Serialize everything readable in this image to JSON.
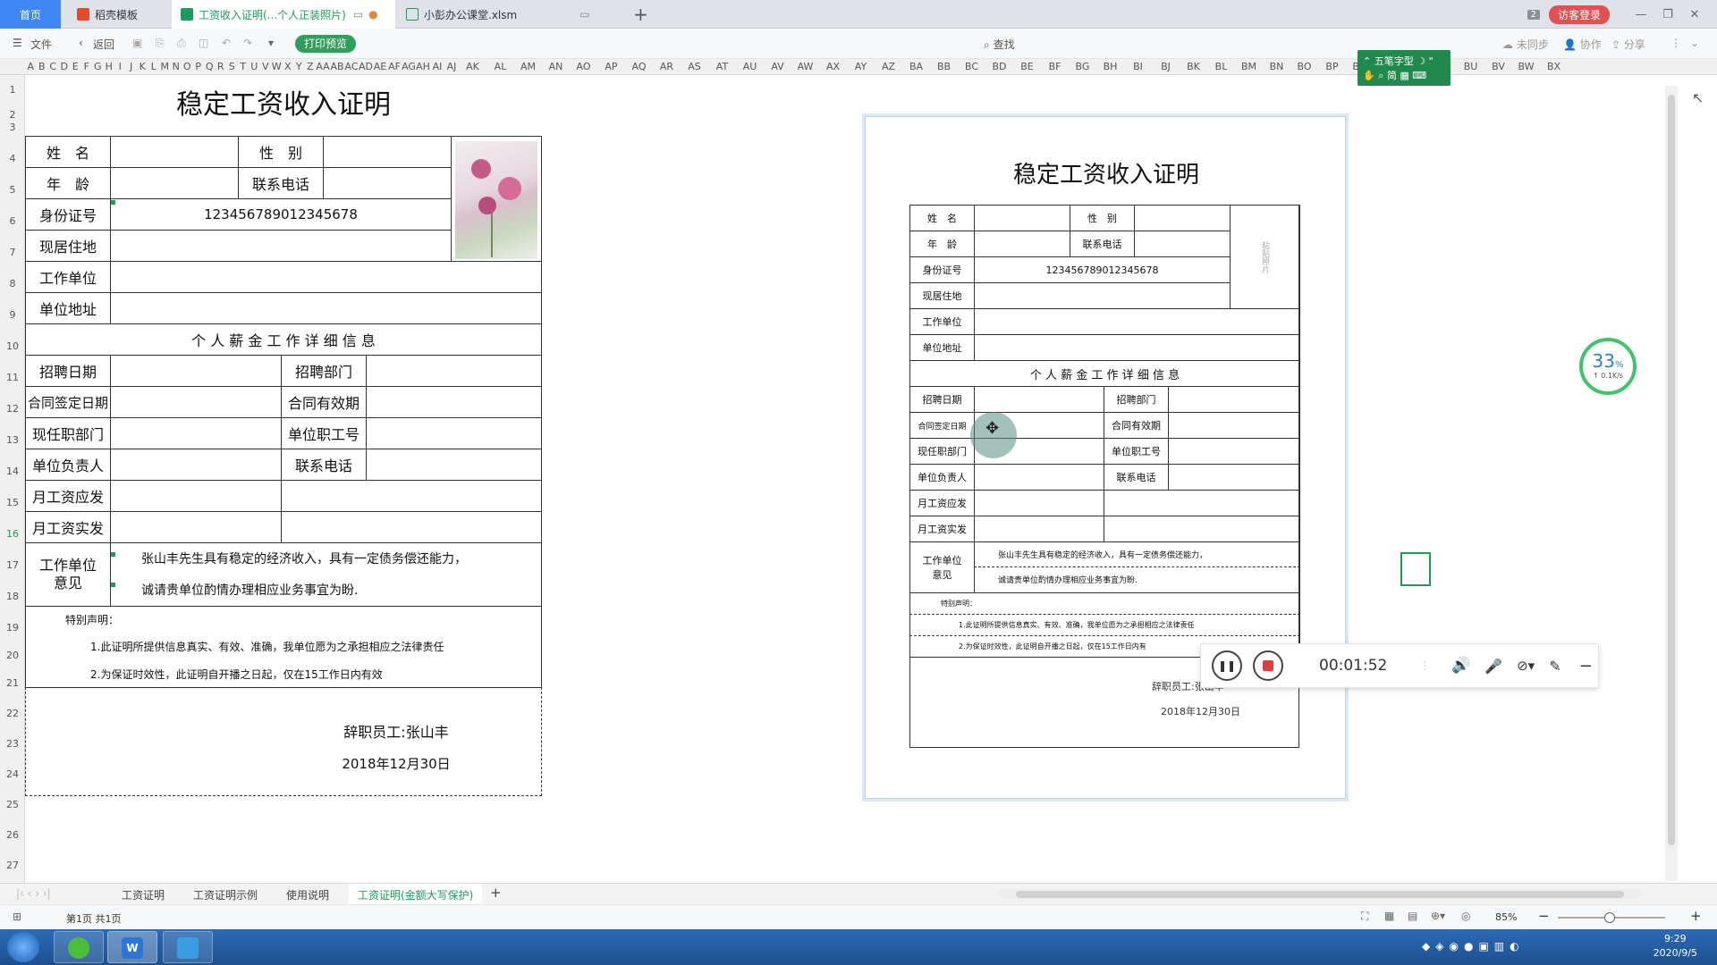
{
  "tabs": {
    "home": "首页",
    "t1": "稻壳模板",
    "t2": "工资收入证明(...个人正装照片)",
    "t3": "小彭办公课堂.xlsm",
    "badge": "2",
    "login": "访客登录"
  },
  "toolbar": {
    "file": "文件",
    "back": "返回",
    "print_preview": "打印预览",
    "search": "查找",
    "sync": "未同步",
    "collab": "协作",
    "share": "分享"
  },
  "columns": [
    "A",
    "B",
    "C",
    "D",
    "E",
    "F",
    "G",
    "H",
    "I",
    "J",
    "K",
    "L",
    "M",
    "N",
    "O",
    "P",
    "Q",
    "R",
    "S",
    "T",
    "U",
    "V",
    "W",
    "X",
    "Y",
    "Z",
    "AA",
    "AB",
    "AC",
    "AD",
    "AE",
    "AF",
    "AG",
    "AH",
    "AI",
    "AJ",
    "AK",
    "AL",
    "AM",
    "AN",
    "AO",
    "AP",
    "AQ",
    "AR",
    "AS",
    "AT",
    "AU",
    "AV",
    "AW",
    "AX",
    "AY",
    "AZ",
    "BA",
    "BB",
    "BC",
    "BD",
    "BE",
    "BF",
    "BG",
    "BH",
    "BI",
    "BJ",
    "BK",
    "BL",
    "BM",
    "BN",
    "BO",
    "BP",
    "BQ",
    "BR",
    "BS",
    "BT",
    "BU",
    "BV",
    "BW",
    "BX"
  ],
  "rows": [
    "1",
    "2",
    "3",
    "4",
    "5",
    "6",
    "7",
    "8",
    "9",
    "10",
    "11",
    "12",
    "13",
    "14",
    "15",
    "16",
    "17",
    "18",
    "19",
    "20",
    "21",
    "22",
    "23",
    "24",
    "25",
    "26",
    "27"
  ],
  "form": {
    "title": "稳定工资收入证明",
    "name": "姓　名",
    "gender": "性　别",
    "age": "年　龄",
    "phone": "联系电话",
    "idno": "身份证号",
    "idval": "123456789012345678",
    "addr": "现居住地",
    "work": "工作单位",
    "workaddr": "单位地址",
    "section": "个 人 薪 金 工 作 详 细 信 息",
    "hire": "招聘日期",
    "dept": "招聘部门",
    "contract": "合同签定日期",
    "valid": "合同有效期",
    "curdept": "现任职部门",
    "empno": "单位职工号",
    "lead": "单位负责人",
    "leadphone": "联系电话",
    "due": "月工资应发",
    "paid": "月工资实发",
    "opinion": "工作单位意见",
    "op1": "张山丰先生具有稳定的经济收入，具有一定债务偿还能力，",
    "op2": "诚请贵单位酌情办理相应业务事宜为盼.",
    "note": "特别声明：",
    "n1": "1.此证明所提供信息真实、有效、准确，我单位愿为之承担相应之法律责任",
    "n2": "2.为保证时效性，此证明自开播之日起，仅在15工作日内有效",
    "sign": "辞职员工:张山丰",
    "date": "2018年12月30日",
    "photo_label": "粘贴照片"
  },
  "preview": {
    "n2": "2.为保证时效性，此证明自开播之日起，仅在15工作日内有"
  },
  "ime": {
    "l1": "五笔字型",
    "l2": "简"
  },
  "recorder": {
    "time": "00:01:52"
  },
  "speed": {
    "pct": "33",
    "unit": "%",
    "rate": "↑ 0.1K/s"
  },
  "sheets": [
    "工资证明",
    "工资证明示例",
    "使用说明",
    "工资证明(金额大写保护)"
  ],
  "status": {
    "page": "第1页 共1页",
    "zoom": "85%"
  },
  "clock": {
    "time": "9:29",
    "date": "2020/9/5"
  },
  "colors": {
    "accent_green": "#1a9c5b",
    "home_blue": "#3f87f5",
    "login_red": "#e05252"
  }
}
